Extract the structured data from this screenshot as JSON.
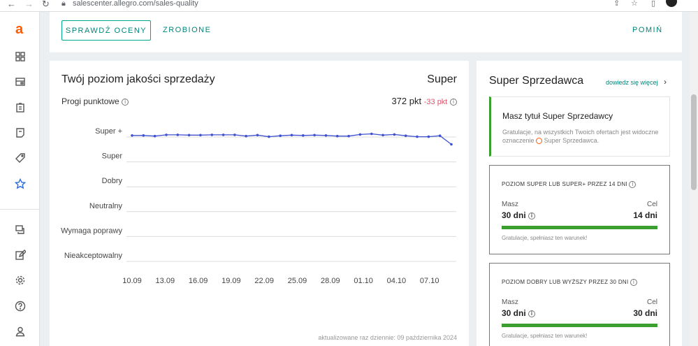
{
  "browser": {
    "url": "salescenter.allegro.com/sales-quality"
  },
  "sidebar": {
    "logo": "a"
  },
  "topbar": {
    "check_ratings": "SPRAWDŹ OCENY",
    "done": "ZROBIONE",
    "skip": "POMIŃ"
  },
  "quality": {
    "title": "Twój poziom jakości sprzedaży",
    "level": "Super",
    "thresholds_label": "Progi punktowe",
    "points": "372 pkt",
    "delta": "-33 pkt",
    "updated": "aktualizowane raz dziennie: 09 października 2024"
  },
  "chart_data": {
    "type": "line",
    "y_categories": [
      "Super +",
      "Super",
      "Dobry",
      "Neutralny",
      "Wymaga poprawy",
      "Nieakceptowalny"
    ],
    "x_tick_labels": [
      "10.09",
      "13.09",
      "16.09",
      "19.09",
      "22.09",
      "25.09",
      "28.09",
      "01.10",
      "04.10",
      "07.10"
    ],
    "series_values": [
      400,
      400,
      398,
      402,
      402,
      401,
      401,
      402,
      402,
      402,
      398,
      401,
      396,
      399,
      401,
      400,
      401,
      400,
      398,
      398,
      403,
      405,
      401,
      403,
      399,
      396,
      396,
      399,
      372
    ],
    "scale_note": "y values are quality points; Super+ band line at ~405",
    "color": "#3f51d0"
  },
  "super_seller": {
    "title": "Super Sprzedawca",
    "learn_more": "dowiedz się więcej",
    "banner_title": "Masz tytuł Super Sprzedawcy",
    "banner_text_1": "Gratulacje, na wszystkich Twoich ofertach jest widoczne oznaczenie",
    "banner_text_2": "Super Sprzedawca.",
    "box1": {
      "heading": "POZIOM SUPER LUB SUPER+ PRZEZ 14 DNI",
      "have_label": "Masz",
      "have_value": "30 dni",
      "goal_label": "Cel",
      "goal_value": "14 dni",
      "progress": 1.0,
      "ok_text": "Gratulacje, spełniasz ten warunek!"
    },
    "box2": {
      "heading": "POZIOM DOBRY LUB WYŻSZY PRZEZ 30 DNI",
      "have_label": "Masz",
      "have_value": "30 dni",
      "goal_label": "Cel",
      "goal_value": "30 dni",
      "progress": 1.0,
      "ok_text": "Gratulacje, spełniasz ten warunek!"
    }
  }
}
